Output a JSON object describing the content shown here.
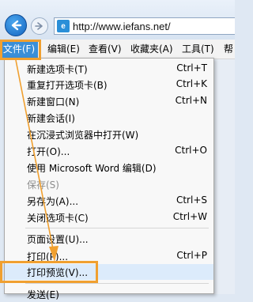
{
  "address_bar": {
    "url": "http://www.iefans.net/",
    "favicon_text": "e"
  },
  "menubar": {
    "file": "文件(F)",
    "edit": "编辑(E)",
    "view": "查看(V)",
    "favorites": "收藏夹(A)",
    "tools": "工具(T)",
    "help": "帮"
  },
  "file_menu": {
    "items": [
      {
        "label": "新建选项卡(T)",
        "shortcut": "Ctrl+T"
      },
      {
        "label": "重复打开选项卡(B)",
        "shortcut": "Ctrl+K"
      },
      {
        "label": "新建窗口(N)",
        "shortcut": "Ctrl+N"
      },
      {
        "label": "新建会话(I)",
        "shortcut": ""
      },
      {
        "label": "在沉浸式浏览器中打开(W)",
        "shortcut": ""
      },
      {
        "label": "打开(O)...",
        "shortcut": "Ctrl+O"
      },
      {
        "label": "使用 Microsoft Word 编辑(D)",
        "shortcut": ""
      },
      {
        "label": "保存(S)",
        "shortcut": "",
        "disabled": true
      },
      {
        "label": "另存为(A)...",
        "shortcut": "Ctrl+S"
      },
      {
        "label": "关闭选项卡(C)",
        "shortcut": "Ctrl+W"
      },
      {
        "label": "页面设置(U)...",
        "shortcut": ""
      },
      {
        "label": "打印(P)...",
        "shortcut": "Ctrl+P"
      },
      {
        "label": "打印预览(V)...",
        "shortcut": ""
      },
      {
        "label": "发送(E)",
        "shortcut": ""
      }
    ]
  },
  "annotation_color": "#f0a030"
}
